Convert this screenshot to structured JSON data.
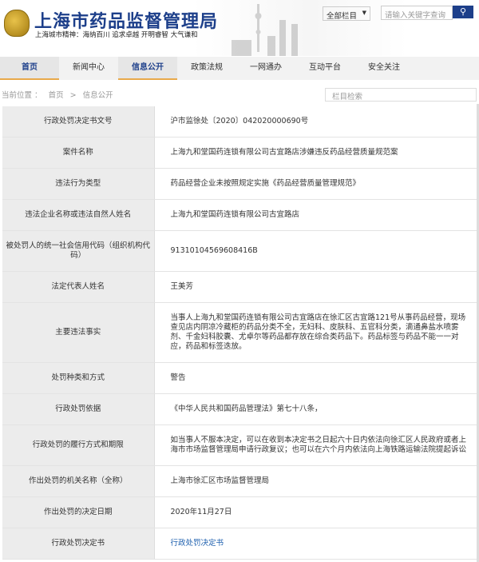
{
  "header": {
    "title": "上海市药品监督管理局",
    "slogan": "上海城市精神：海纳百川  追求卓越  开明睿智  大气谦和",
    "scope_select": "全部栏目",
    "search_placeholder": "请输入关键字查询"
  },
  "nav": [
    "首页",
    "新闻中心",
    "信息公开",
    "政策法规",
    "一网通办",
    "互动平台",
    "安全关注"
  ],
  "breadcrumb": {
    "label": "当前位置 ：",
    "home": "首页",
    "sep": ">",
    "current": "信息公开"
  },
  "column_search_placeholder": "栏目检索",
  "rows": [
    {
      "label": "行政处罚决定书文号",
      "value": "沪市监徐处〔2020〕042020000690号"
    },
    {
      "label": "案件名称",
      "value": "上海九和堂国药连锁有限公司古宜路店涉嫌违反药品经营质量规范案"
    },
    {
      "label": "违法行为类型",
      "value": "药品经营企业未按照规定实施《药品经营质量管理规范》"
    },
    {
      "label": "违法企业名称或违法自然人姓名",
      "value": "上海九和堂国药连锁有限公司古宜路店"
    },
    {
      "label": "被处罚人的统一社会信用代码（组织机构代码）",
      "value": "91310104569608416B"
    },
    {
      "label": "法定代表人姓名",
      "value": "王美芳"
    },
    {
      "label": "主要违法事实",
      "value": "当事人上海九和堂国药连锁有限公司古宜路店在徐汇区古宜路121号从事药品经营，现场查见店内阴凉冷藏柜的药品分类不全，无妇科、皮肤科、五官科分类，滴通鼻盐水喷雾剂、千金妇科胶囊、尤卓尔等药品都存放在综合类药品下。药品标签与药品不能一一对应，药品和标签迭放。"
    },
    {
      "label": "处罚种类和方式",
      "value": "警告"
    },
    {
      "label": "行政处罚依据",
      "value": "《中华人民共和国药品管理法》第七十八条，"
    },
    {
      "label": "行政处罚的履行方式和期限",
      "value": "如当事人不服本决定，可以在收到本决定书之日起六十日内依法向徐汇区人民政府或者上海市市场监督管理局申请行政复议；也可以在六个月内依法向上海铁路运输法院提起诉讼"
    },
    {
      "label": "作出处罚的机关名称（全称）",
      "value": "上海市徐汇区市场监督管理局"
    },
    {
      "label": "作出处罚的决定日期",
      "value": "2020年11月27日"
    },
    {
      "label": "行政处罚决定书",
      "value": "行政处罚决定书"
    }
  ]
}
